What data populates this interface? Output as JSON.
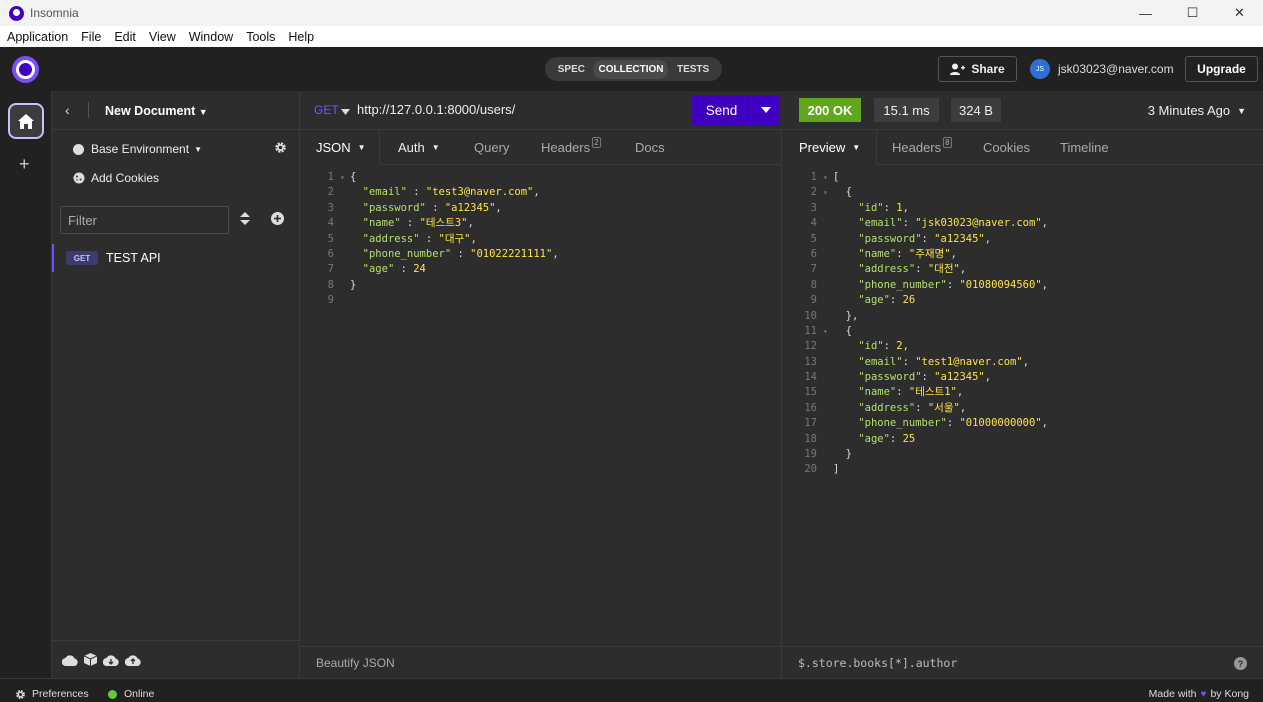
{
  "window": {
    "title": "Insomnia",
    "minimize": "—",
    "maximize": "☐",
    "close": "✕"
  },
  "menu": [
    "Application",
    "File",
    "Edit",
    "View",
    "Window",
    "Tools",
    "Help"
  ],
  "header": {
    "segments": [
      "SPEC",
      "COLLECTION",
      "TESTS"
    ],
    "active_segment": "COLLECTION",
    "share_label": "Share",
    "avatar_initials": "JS",
    "user_email": "jsk03023@naver.com",
    "upgrade_label": "Upgrade"
  },
  "sidebar": {
    "document_name": "New Document",
    "environment": "Base Environment",
    "add_cookies": "Add Cookies",
    "filter_placeholder": "Filter",
    "requests": [
      {
        "method": "GET",
        "name": "TEST API"
      }
    ]
  },
  "request": {
    "method": "GET",
    "url": "http://127.0.0.1:8000/users/",
    "send_label": "Send",
    "tabs": [
      {
        "label": "JSON",
        "active": true
      },
      {
        "label": "Auth"
      },
      {
        "label": "Query"
      },
      {
        "label": "Headers",
        "badge": "2"
      },
      {
        "label": "Docs"
      }
    ],
    "footer": "Beautify JSON",
    "body_lines": [
      [
        "1",
        "▾",
        [
          [
            "p",
            "{"
          ]
        ]
      ],
      [
        "2",
        "",
        [
          [
            "p",
            "  "
          ],
          [
            "k",
            "\"email\""
          ],
          [
            "p",
            " : "
          ],
          [
            "s",
            "\"test3@naver.com\""
          ],
          [
            "p",
            ","
          ]
        ]
      ],
      [
        "3",
        "",
        [
          [
            "p",
            "  "
          ],
          [
            "k",
            "\"password\""
          ],
          [
            "p",
            " : "
          ],
          [
            "s",
            "\"a12345\""
          ],
          [
            "p",
            ","
          ]
        ]
      ],
      [
        "4",
        "",
        [
          [
            "p",
            "  "
          ],
          [
            "k",
            "\"name\""
          ],
          [
            "p",
            " : "
          ],
          [
            "s",
            "\"테스트3\""
          ],
          [
            "p",
            ","
          ]
        ]
      ],
      [
        "5",
        "",
        [
          [
            "p",
            "  "
          ],
          [
            "k",
            "\"address\""
          ],
          [
            "p",
            " : "
          ],
          [
            "s",
            "\"대구\""
          ],
          [
            "p",
            ","
          ]
        ]
      ],
      [
        "6",
        "",
        [
          [
            "p",
            "  "
          ],
          [
            "k",
            "\"phone_number\""
          ],
          [
            "p",
            " : "
          ],
          [
            "s",
            "\"01022221111\""
          ],
          [
            "p",
            ","
          ]
        ]
      ],
      [
        "7",
        "",
        [
          [
            "p",
            "  "
          ],
          [
            "k",
            "\"age\""
          ],
          [
            "p",
            " : "
          ],
          [
            "n",
            "24"
          ]
        ]
      ],
      [
        "8",
        "",
        [
          [
            "p",
            "}"
          ]
        ]
      ],
      [
        "9",
        "",
        [
          [
            "p",
            ""
          ]
        ]
      ]
    ]
  },
  "response": {
    "status": "200 OK",
    "time": "15.1 ms",
    "size": "324 B",
    "ago": "3 Minutes Ago",
    "tabs": [
      {
        "label": "Preview",
        "active": true
      },
      {
        "label": "Headers",
        "badge": "8"
      },
      {
        "label": "Cookies"
      },
      {
        "label": "Timeline"
      }
    ],
    "filter_placeholder": "$.store.books[*].author",
    "help": "?",
    "body_lines": [
      [
        "1",
        "▾",
        [
          [
            "p",
            "["
          ]
        ]
      ],
      [
        "2",
        "▾",
        [
          [
            "p",
            "  {"
          ]
        ]
      ],
      [
        "3",
        "",
        [
          [
            "p",
            "    "
          ],
          [
            "k",
            "\"id\""
          ],
          [
            "p",
            ": "
          ],
          [
            "n",
            "1"
          ],
          [
            "p",
            ","
          ]
        ]
      ],
      [
        "4",
        "",
        [
          [
            "p",
            "    "
          ],
          [
            "k",
            "\"email\""
          ],
          [
            "p",
            ": "
          ],
          [
            "s",
            "\"jsk03023@naver.com\""
          ],
          [
            "p",
            ","
          ]
        ]
      ],
      [
        "5",
        "",
        [
          [
            "p",
            "    "
          ],
          [
            "k",
            "\"password\""
          ],
          [
            "p",
            ": "
          ],
          [
            "s",
            "\"a12345\""
          ],
          [
            "p",
            ","
          ]
        ]
      ],
      [
        "6",
        "",
        [
          [
            "p",
            "    "
          ],
          [
            "k",
            "\"name\""
          ],
          [
            "p",
            ": "
          ],
          [
            "s",
            "\"주재명\""
          ],
          [
            "p",
            ","
          ]
        ]
      ],
      [
        "7",
        "",
        [
          [
            "p",
            "    "
          ],
          [
            "k",
            "\"address\""
          ],
          [
            "p",
            ": "
          ],
          [
            "s",
            "\"대전\""
          ],
          [
            "p",
            ","
          ]
        ]
      ],
      [
        "8",
        "",
        [
          [
            "p",
            "    "
          ],
          [
            "k",
            "\"phone_number\""
          ],
          [
            "p",
            ": "
          ],
          [
            "s",
            "\"01080094560\""
          ],
          [
            "p",
            ","
          ]
        ]
      ],
      [
        "9",
        "",
        [
          [
            "p",
            "    "
          ],
          [
            "k",
            "\"age\""
          ],
          [
            "p",
            ": "
          ],
          [
            "n",
            "26"
          ]
        ]
      ],
      [
        "10",
        "",
        [
          [
            "p",
            "  },"
          ]
        ]
      ],
      [
        "11",
        "▾",
        [
          [
            "p",
            "  {"
          ]
        ]
      ],
      [
        "12",
        "",
        [
          [
            "p",
            "    "
          ],
          [
            "k",
            "\"id\""
          ],
          [
            "p",
            ": "
          ],
          [
            "n",
            "2"
          ],
          [
            "p",
            ","
          ]
        ]
      ],
      [
        "13",
        "",
        [
          [
            "p",
            "    "
          ],
          [
            "k",
            "\"email\""
          ],
          [
            "p",
            ": "
          ],
          [
            "s",
            "\"test1@naver.com\""
          ],
          [
            "p",
            ","
          ]
        ]
      ],
      [
        "14",
        "",
        [
          [
            "p",
            "    "
          ],
          [
            "k",
            "\"password\""
          ],
          [
            "p",
            ": "
          ],
          [
            "s",
            "\"a12345\""
          ],
          [
            "p",
            ","
          ]
        ]
      ],
      [
        "15",
        "",
        [
          [
            "p",
            "    "
          ],
          [
            "k",
            "\"name\""
          ],
          [
            "p",
            ": "
          ],
          [
            "s",
            "\"테스트1\""
          ],
          [
            "p",
            ","
          ]
        ]
      ],
      [
        "16",
        "",
        [
          [
            "p",
            "    "
          ],
          [
            "k",
            "\"address\""
          ],
          [
            "p",
            ": "
          ],
          [
            "s",
            "\"서울\""
          ],
          [
            "p",
            ","
          ]
        ]
      ],
      [
        "17",
        "",
        [
          [
            "p",
            "    "
          ],
          [
            "k",
            "\"phone_number\""
          ],
          [
            "p",
            ": "
          ],
          [
            "s",
            "\"01000000000\""
          ],
          [
            "p",
            ","
          ]
        ]
      ],
      [
        "18",
        "",
        [
          [
            "p",
            "    "
          ],
          [
            "k",
            "\"age\""
          ],
          [
            "p",
            ": "
          ],
          [
            "n",
            "25"
          ]
        ]
      ],
      [
        "19",
        "",
        [
          [
            "p",
            "  }"
          ]
        ]
      ],
      [
        "20",
        "",
        [
          [
            "p",
            "]"
          ]
        ]
      ]
    ]
  },
  "statusbar": {
    "preferences": "Preferences",
    "online": "Online",
    "made_with": "Made with",
    "heart": "♥",
    "by_kong": "by Kong"
  },
  "colors": {
    "accent": "#4000bf",
    "status_ok": "#5fa81e",
    "json_key": "#b4e06a",
    "json_value": "#fde34b"
  }
}
